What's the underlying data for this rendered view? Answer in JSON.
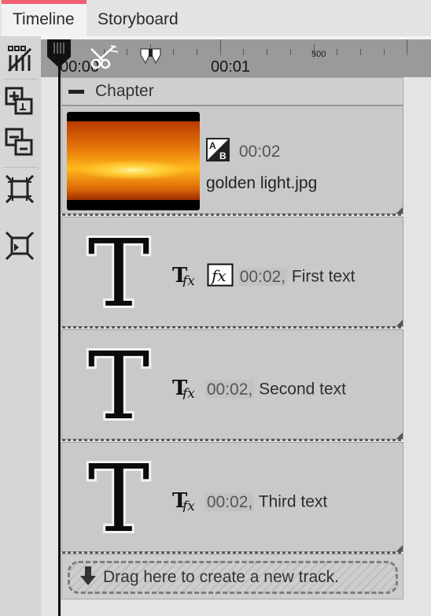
{
  "tabs": [
    {
      "label": "Timeline",
      "active": true
    },
    {
      "label": "Storyboard",
      "active": false
    }
  ],
  "toolbar": {
    "icons": [
      "remove-effects-icon",
      "add-track-icon",
      "remove-track-icon",
      "zoom-out-icon",
      "zoom-fit-icon"
    ]
  },
  "ruler": {
    "time_start": "00:00",
    "time_mid": "00:01",
    "ms_label": "500",
    "icons": [
      "scissors-icon",
      "marker-icon"
    ]
  },
  "chapter": {
    "label": "Chapter"
  },
  "clips": [
    {
      "type": "image",
      "duration": "00:02",
      "name": "golden light.jpg",
      "icon": "transition-ab-icon"
    },
    {
      "type": "text",
      "duration": "00:02,",
      "name": "First text",
      "icons": [
        "text-fx-icon",
        "fx-box-icon"
      ]
    },
    {
      "type": "text",
      "duration": "00:02,",
      "name": "Second text",
      "icons": [
        "text-fx-icon"
      ]
    },
    {
      "type": "text",
      "duration": "00:02,",
      "name": "Third text",
      "icons": [
        "text-fx-icon"
      ]
    }
  ],
  "drop_zone": {
    "label": "Drag here to create a new track."
  },
  "colors": {
    "tab_accent": "#f06070",
    "ruler": "#9a9a9a",
    "clip_bg": "#c9c9c9",
    "playhead": "#0d0d0d"
  }
}
